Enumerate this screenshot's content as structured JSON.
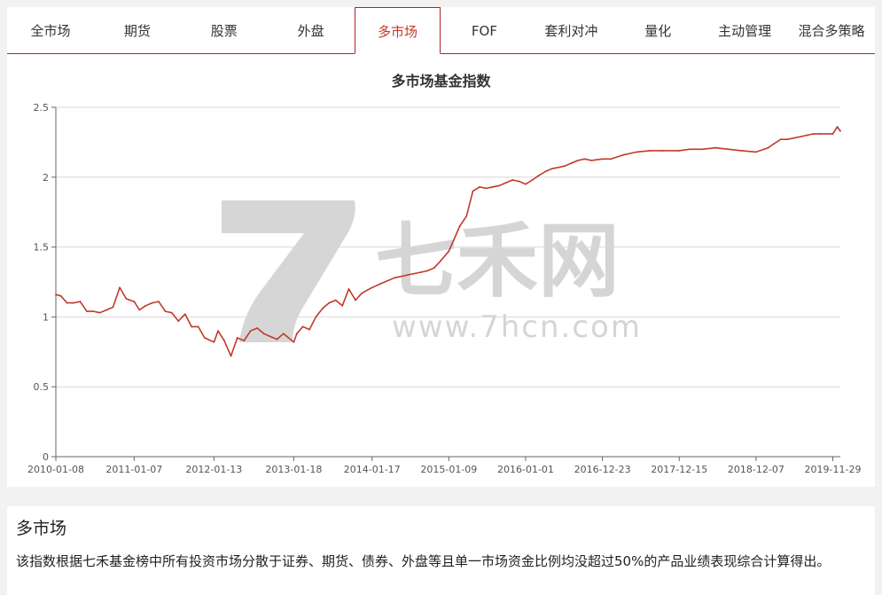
{
  "tabs": [
    {
      "label": "全市场"
    },
    {
      "label": "期货"
    },
    {
      "label": "股票"
    },
    {
      "label": "外盘"
    },
    {
      "label": "多市场"
    },
    {
      "label": "FOF"
    },
    {
      "label": "套利对冲"
    },
    {
      "label": "量化"
    },
    {
      "label": "主动管理"
    },
    {
      "label": "混合多策略"
    }
  ],
  "active_tab_index": 4,
  "colors": {
    "accent": "#b22222",
    "line": "#c0392b",
    "watermark": "#c8c8c8"
  },
  "watermark": {
    "brand": "七禾网",
    "url": "www.7hcn.com"
  },
  "chart_data": {
    "type": "line",
    "title": "多市场基金指数",
    "xlabel": "",
    "ylabel": "",
    "ylim": [
      0,
      2.5
    ],
    "yticks": [
      0,
      0.5,
      1,
      1.5,
      2,
      2.5
    ],
    "ytick_labels": [
      "0",
      "0.5",
      "1",
      "1.5",
      "2",
      "2.5"
    ],
    "xlim": [
      "2010-01-08",
      "2020-01-03"
    ],
    "xticks": [
      "2010-01-08",
      "2011-01-07",
      "2012-01-13",
      "2013-01-18",
      "2014-01-17",
      "2015-01-09",
      "2016-01-01",
      "2016-12-23",
      "2017-12-15",
      "2018-12-07",
      "2019-11-29"
    ],
    "grid": true,
    "legend": "none",
    "series": [
      {
        "x": [
          "2010-01-08",
          "2010-02-01",
          "2010-03-01",
          "2010-04-01",
          "2010-05-01",
          "2010-06-01",
          "2010-07-01",
          "2010-08-01",
          "2010-09-01",
          "2010-10-01",
          "2010-11-01",
          "2010-12-01",
          "2011-01-07",
          "2011-02-01",
          "2011-03-01",
          "2011-04-01",
          "2011-05-01",
          "2011-06-01",
          "2011-07-01",
          "2011-08-01",
          "2011-09-01",
          "2011-10-01",
          "2011-11-01",
          "2011-12-01",
          "2012-01-13",
          "2012-02-01",
          "2012-03-01",
          "2012-04-01",
          "2012-05-01",
          "2012-06-01",
          "2012-07-01",
          "2012-08-01",
          "2012-09-01",
          "2012-10-01",
          "2012-11-01",
          "2012-12-01",
          "2013-01-18",
          "2013-02-01",
          "2013-03-01",
          "2013-04-01",
          "2013-05-01",
          "2013-06-01",
          "2013-07-01",
          "2013-08-01",
          "2013-09-01",
          "2013-10-01",
          "2013-11-01",
          "2013-12-01",
          "2014-01-17",
          "2014-03-01",
          "2014-05-01",
          "2014-07-01",
          "2014-09-01",
          "2014-10-01",
          "2014-11-01",
          "2014-12-01",
          "2015-01-09",
          "2015-02-01",
          "2015-03-01",
          "2015-04-01",
          "2015-05-01",
          "2015-06-01",
          "2015-07-01",
          "2015-08-01",
          "2015-09-01",
          "2015-10-01",
          "2015-11-01",
          "2015-12-01",
          "2016-01-01",
          "2016-02-01",
          "2016-03-01",
          "2016-04-01",
          "2016-05-01",
          "2016-06-01",
          "2016-07-01",
          "2016-08-01",
          "2016-09-01",
          "2016-10-01",
          "2016-11-01",
          "2016-12-23",
          "2017-02-01",
          "2017-04-01",
          "2017-06-01",
          "2017-08-01",
          "2017-10-01",
          "2017-12-15",
          "2018-02-01",
          "2018-04-01",
          "2018-06-01",
          "2018-08-01",
          "2018-10-01",
          "2018-12-07",
          "2019-02-01",
          "2019-03-01",
          "2019-04-01",
          "2019-05-01",
          "2019-06-01",
          "2019-07-01",
          "2019-08-01",
          "2019-09-01",
          "2019-10-01",
          "2019-11-29",
          "2019-12-20",
          "2020-01-03"
        ],
        "values": [
          1.16,
          1.15,
          1.1,
          1.1,
          1.11,
          1.04,
          1.04,
          1.03,
          1.05,
          1.07,
          1.21,
          1.13,
          1.11,
          1.05,
          1.08,
          1.1,
          1.11,
          1.04,
          1.03,
          0.97,
          1.02,
          0.93,
          0.93,
          0.85,
          0.82,
          0.9,
          0.83,
          0.72,
          0.85,
          0.83,
          0.9,
          0.92,
          0.88,
          0.86,
          0.84,
          0.88,
          0.82,
          0.88,
          0.93,
          0.91,
          1.0,
          1.06,
          1.1,
          1.12,
          1.08,
          1.2,
          1.12,
          1.17,
          1.21,
          1.24,
          1.28,
          1.3,
          1.32,
          1.33,
          1.35,
          1.4,
          1.47,
          1.55,
          1.65,
          1.72,
          1.9,
          1.93,
          1.92,
          1.93,
          1.94,
          1.96,
          1.98,
          1.97,
          1.95,
          1.98,
          2.01,
          2.04,
          2.06,
          2.07,
          2.08,
          2.1,
          2.12,
          2.13,
          2.12,
          2.13,
          2.13,
          2.16,
          2.18,
          2.19,
          2.19,
          2.19,
          2.2,
          2.2,
          2.21,
          2.2,
          2.19,
          2.18,
          2.21,
          2.24,
          2.27,
          2.27,
          2.28,
          2.29,
          2.3,
          2.31,
          2.31,
          2.31,
          2.36,
          2.33
        ]
      }
    ]
  },
  "description": {
    "title": "多市场",
    "text": "该指数根据七禾基金榜中所有投资市场分散于证券、期货、债券、外盘等且单一市场资金比例均没超过50%的产品业绩表现综合计算得出。"
  }
}
